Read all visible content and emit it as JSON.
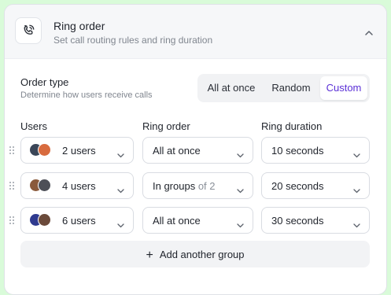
{
  "header": {
    "icon": "phone-ring-icon",
    "title": "Ring order",
    "subtitle": "Set call routing rules and ring duration"
  },
  "order_type": {
    "label": "Order type",
    "description": "Determine how users receive calls",
    "options": [
      "All at once",
      "Random",
      "Custom"
    ],
    "selected": "Custom"
  },
  "columns": {
    "users": "Users",
    "ring_order": "Ring order",
    "ring_duration": "Ring duration"
  },
  "rows": [
    {
      "users": "2 users",
      "ring_order": "All at once",
      "ring_order_suffix": "",
      "ring_duration": "10 seconds"
    },
    {
      "users": "4 users",
      "ring_order": "In groups",
      "ring_order_suffix": "of 2",
      "ring_duration": "20 seconds"
    },
    {
      "users": "6 users",
      "ring_order": "All at once",
      "ring_order_suffix": "",
      "ring_duration": "30 seconds"
    }
  ],
  "add_group_label": "Add another group",
  "colors": {
    "background": "#d9fbd9",
    "accent": "#5a2fd6"
  }
}
